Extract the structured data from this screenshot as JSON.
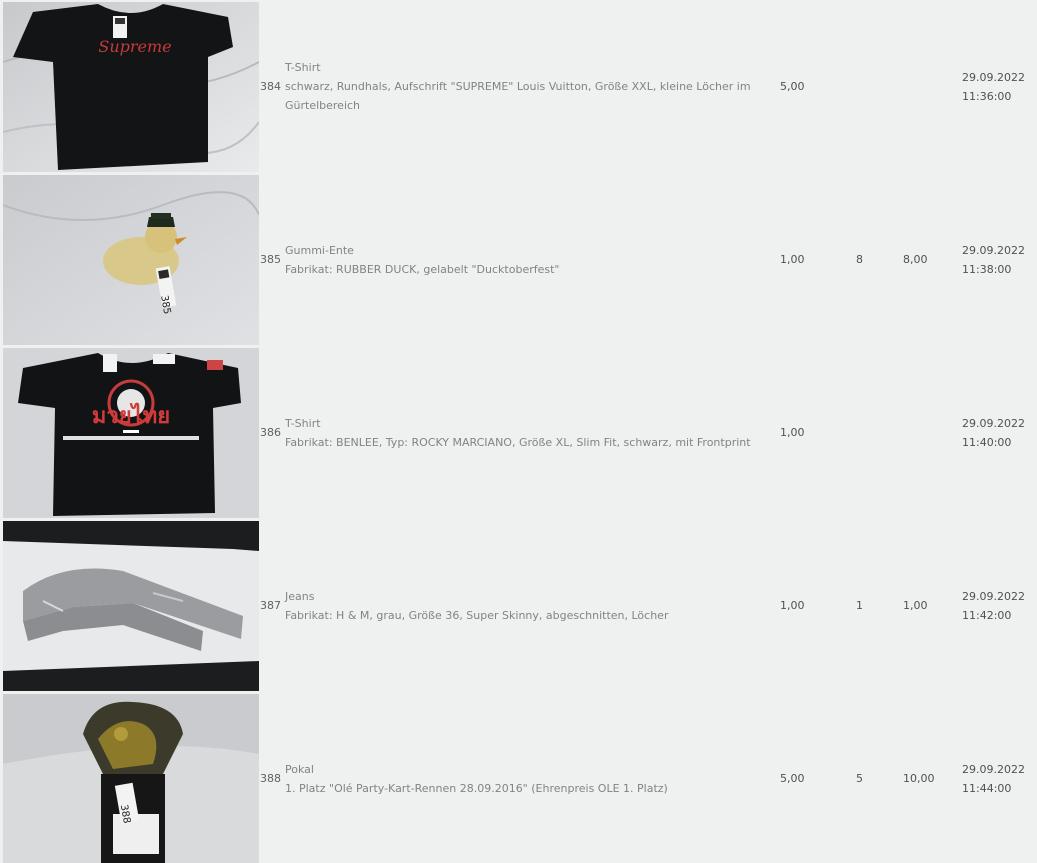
{
  "rows": [
    {
      "lot": "384",
      "title": "T-Shirt",
      "description": "schwarz, Rundhals, Aufschrift \"SUPREME\" Louis Vuitton, Größe XXL, kleine Löcher im Gürtelbereich",
      "start_price": "5,00",
      "bids": "",
      "price": "",
      "date": "29.09.2022",
      "time": "11:36:00",
      "image": "black-supreme-tshirt-photo",
      "image_text": "Supreme"
    },
    {
      "lot": "385",
      "title": "Gummi-Ente",
      "description": "Fabrikat: RUBBER DUCK, gelabelt \"Ducktoberfest\"",
      "start_price": "1,00",
      "bids": "8",
      "price": "8,00",
      "date": "29.09.2022",
      "time": "11:38:00",
      "image": "rubber-duck-photo",
      "image_text": "385"
    },
    {
      "lot": "386",
      "title": "T-Shirt",
      "description": "Fabrikat: BENLEE, Typ: ROCKY MARCIANO, Größe XL, Slim Fit, schwarz, mit Frontprint",
      "start_price": "1,00",
      "bids": "",
      "price": "",
      "date": "29.09.2022",
      "time": "11:40:00",
      "image": "black-muay-thai-tshirt-photo",
      "image_text": "มวยไทย"
    },
    {
      "lot": "387",
      "title": "Jeans",
      "description": "Fabrikat: H & M, grau, Größe 36, Super Skinny, abgeschnitten, Löcher",
      "start_price": "1,00",
      "bids": "1",
      "price": "1,00",
      "date": "29.09.2022",
      "time": "11:42:00",
      "image": "grey-jeans-photo",
      "image_text": ""
    },
    {
      "lot": "388",
      "title": "Pokal",
      "description": "1. Platz \"Olé Party-Kart-Rennen 28.09.2016\" (Ehrenpreis OLE 1. Platz)",
      "start_price": "5,00",
      "bids": "5",
      "price": "10,00",
      "date": "29.09.2022",
      "time": "11:44:00",
      "image": "kart-trophy-photo",
      "image_text": "388"
    }
  ],
  "colors": {
    "background": "#eff1f0",
    "text_muted": "#7f8484",
    "text_dark": "#4d5252"
  }
}
